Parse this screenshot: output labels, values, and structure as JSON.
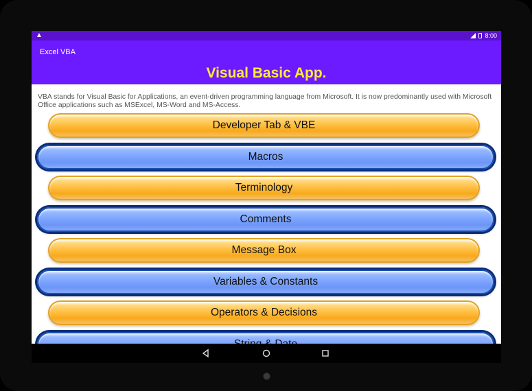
{
  "status": {
    "time": "8:00"
  },
  "app": {
    "title": "Excel VBA"
  },
  "page": {
    "title": "Visual Basic App.",
    "intro": "VBA stands for Visual Basic for Applications, an event-driven programming language from Microsoft. It is now predominantly used with Microsoft Office applications such as MSExcel, MS-Word and MS-Access."
  },
  "menu": [
    {
      "label": "Developer Tab & VBE",
      "style": "orange"
    },
    {
      "label": "Macros",
      "style": "blue"
    },
    {
      "label": "Terminology",
      "style": "orange"
    },
    {
      "label": "Comments",
      "style": "blue"
    },
    {
      "label": "Message Box",
      "style": "orange"
    },
    {
      "label": "Variables & Constants",
      "style": "blue"
    },
    {
      "label": "Operators & Decisions",
      "style": "orange"
    },
    {
      "label": "String & Date",
      "style": "blue"
    }
  ],
  "colors": {
    "status_bar": "#5a12cf",
    "app_bar": "#6c1aff",
    "title": "#ffeb3b"
  },
  "icons": [
    "warning-icon",
    "signal-icon",
    "battery-icon",
    "back-icon",
    "home-icon",
    "recents-icon"
  ]
}
